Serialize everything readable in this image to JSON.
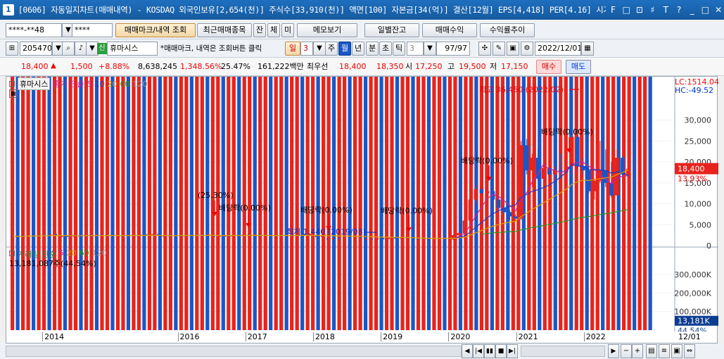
{
  "titlebar": {
    "icon_num": "1",
    "title": "[0606] 자동일지차트(매매내역) - KOSDAQ 외국인보유[2,654(천)] 주식수[33,910(천)] 액면[100] 자본금[34(억)] 결산[12월] EPS[4,418] PER[4.16] 시가",
    "buttons": [
      "F",
      "□",
      "⊡",
      "♯",
      "T",
      "?",
      "_",
      "□",
      "✕"
    ]
  },
  "row1": {
    "account": "****-**48",
    "password": "****",
    "btn_mark": "매매마크/내역 조회",
    "btn_recent": "최근매매종목",
    "btn_jan": "잔",
    "btn_che": "체",
    "btn_mi": "미",
    "btn_memo": "메모보기",
    "btn_daily": "일별잔고",
    "btn_profit": "매매수익",
    "btn_return": "수익률추이"
  },
  "row2": {
    "code": "205470",
    "stock_badge": "신",
    "stock_name": "휴마시스",
    "hint": "*매매마크, 내역은 조회버튼 클릭",
    "period_label": "일",
    "period_value": "3",
    "tabs": [
      "주",
      "월",
      "년",
      "분",
      "초",
      "틱"
    ],
    "active_tab": "월",
    "tick_value": "3",
    "page_count": "97/97",
    "date": "2022/12/01"
  },
  "row3": {
    "price": "18,400",
    "change": "1,500",
    "change_pct": "+8.88%",
    "volume": "8,638,245",
    "vol_ratio": "1,348.56%",
    "turnover": "25.47%",
    "amount": "161,222백만",
    "best_label": "최우선",
    "ask": "18,400",
    "bid": "18,350",
    "open_label": "시",
    "open": "17,250",
    "high_label": "고",
    "high": "19,500",
    "low_label": "저",
    "low": "17,150",
    "buy_btn": "매수",
    "sell_btn": "매도"
  },
  "price_panel": {
    "legend_name": "휴마시스",
    "legend_type": "종가 단순",
    "ma_labels": [
      "5",
      "10",
      "20",
      "60",
      "120"
    ],
    "ma_colors": [
      "#c8209a",
      "#1a3cc8",
      "#e0a000",
      "#209a20",
      "#9a9a9a"
    ],
    "lc": "LC:1514.04",
    "hc": "HC:-49.52",
    "yticks": [
      "30,000",
      "25,000",
      "20,000",
      "15,000",
      "10,000",
      "5,000",
      "0"
    ],
    "current_price": "18,400",
    "current_pct": "13.93%",
    "annotations": {
      "high": "최고 36,450 (2022/02)",
      "low": "최저 1,440 (2019/08)",
      "pct": "(25.30%)",
      "div1": "배당락(0.00%)",
      "div2": "배당락(0.00%)",
      "div3": "배당락(0.00%)",
      "div4": "배당락(0.00%)",
      "div5": "배당락(0.00%)"
    }
  },
  "volume_panel": {
    "legend_name": "거래량",
    "legend_type": "단순",
    "ma_labels": [
      "5",
      "20",
      "60",
      "120"
    ],
    "ma_colors": [
      "#c8209a",
      "#e0a000",
      "#209a20",
      "#9a9a9a"
    ],
    "summary": "13,181,087주(44,54%)",
    "yticks": [
      "300,000K",
      "200,000K",
      "100,000K"
    ],
    "current": "13,181K",
    "current_pct": "44,54%"
  },
  "xaxis": {
    "labels": [
      "2014",
      "2016",
      "2017",
      "2018",
      "2019",
      "2020",
      "2021",
      "2022",
      "12/01"
    ]
  },
  "colors": {
    "up": "#e8231c",
    "down": "#1a56c8",
    "ma5": "#c8209a",
    "ma20": "#e0a000",
    "ma60": "#209a20"
  },
  "chart_data": {
    "type": "candlestick",
    "title": "휴마시스",
    "ylim": [
      0,
      38000
    ],
    "months": [
      "2013-07",
      "2013-08",
      "2013-09",
      "2013-10",
      "2013-11",
      "2013-12",
      "2014-01",
      "2014-02",
      "2014-03",
      "2014-04",
      "2014-05",
      "2014-06",
      "2014-07",
      "2014-08",
      "2014-09",
      "2014-10",
      "2014-11",
      "2014-12",
      "2015-01",
      "2015-02",
      "2015-03",
      "2015-04",
      "2015-05",
      "2015-06",
      "2015-07",
      "2015-08",
      "2015-09",
      "2015-10",
      "2015-11",
      "2015-12",
      "2016-01",
      "2016-02",
      "2016-03",
      "2016-04",
      "2016-05",
      "2016-06",
      "2016-07",
      "2016-08",
      "2016-09",
      "2016-10",
      "2016-11",
      "2016-12",
      "2017-01",
      "2017-02",
      "2017-03",
      "2017-04",
      "2017-05",
      "2017-06",
      "2017-07",
      "2017-08",
      "2017-09",
      "2017-10",
      "2017-11",
      "2017-12",
      "2018-01",
      "2018-02",
      "2018-03",
      "2018-04",
      "2018-05",
      "2018-06",
      "2018-07",
      "2018-08",
      "2018-09",
      "2018-10",
      "2018-11",
      "2018-12",
      "2019-01",
      "2019-02",
      "2019-03",
      "2019-04",
      "2019-05",
      "2019-06",
      "2019-07",
      "2019-08",
      "2019-09",
      "2019-10",
      "2019-11",
      "2019-12",
      "2020-01",
      "2020-02",
      "2020-03",
      "2020-04",
      "2020-05",
      "2020-06",
      "2020-07",
      "2020-08",
      "2020-09",
      "2020-10",
      "2020-11",
      "2020-12",
      "2021-01",
      "2021-02",
      "2021-03",
      "2021-04",
      "2021-05",
      "2021-06",
      "2021-07",
      "2021-08",
      "2021-09",
      "2021-10",
      "2021-11",
      "2021-12",
      "2022-01",
      "2022-02",
      "2022-03",
      "2022-04",
      "2022-05",
      "2022-06",
      "2022-07",
      "2022-08",
      "2022-09",
      "2022-10",
      "2022-11",
      "2022-12"
    ],
    "candles_ohlc_2020_2022": [
      [
        1500,
        2600,
        1400,
        2500
      ],
      [
        2500,
        3200,
        2300,
        3000
      ],
      [
        3000,
        6500,
        2900,
        6000
      ],
      [
        6000,
        12000,
        5800,
        11000
      ],
      [
        11000,
        14500,
        10000,
        13500
      ],
      [
        13500,
        14200,
        12000,
        12500
      ],
      [
        12500,
        13500,
        11500,
        13000
      ],
      [
        13000,
        13500,
        10500,
        11000
      ],
      [
        11000,
        11500,
        8500,
        9000
      ],
      [
        9000,
        9500,
        7500,
        8000
      ],
      [
        8000,
        8500,
        6000,
        7000
      ],
      [
        7000,
        7500,
        5800,
        6500
      ],
      [
        6500,
        25000,
        6200,
        24000
      ],
      [
        24000,
        25500,
        17000,
        18000
      ],
      [
        18000,
        22000,
        14000,
        21000
      ],
      [
        21000,
        23000,
        15000,
        16000
      ],
      [
        16000,
        19500,
        15500,
        18500
      ],
      [
        18500,
        19000,
        16000,
        17000
      ],
      [
        17000,
        19000,
        15500,
        18000
      ],
      [
        18000,
        22000,
        16000,
        17500
      ],
      [
        17500,
        21000,
        16500,
        19000
      ],
      [
        19000,
        27000,
        17000,
        26000
      ],
      [
        26000,
        36450,
        18000,
        19000
      ],
      [
        19000,
        21000,
        17000,
        18000
      ],
      [
        18000,
        19000,
        12500,
        13000
      ],
      [
        13000,
        16000,
        11000,
        15500
      ],
      [
        15500,
        25000,
        15000,
        18000
      ],
      [
        18000,
        23000,
        14000,
        15000
      ],
      [
        15000,
        20000,
        11500,
        12000
      ],
      [
        12000,
        23000,
        12000,
        21000
      ],
      [
        21000,
        21500,
        16500,
        17000
      ],
      [
        16900,
        19500,
        15000,
        18400
      ]
    ],
    "volume_k": [
      2000,
      3000,
      5000,
      4000,
      6000,
      20000,
      3000,
      25000,
      8000,
      4000,
      3000,
      6000,
      5000,
      4000,
      3000,
      25000,
      10000,
      6000,
      4000,
      3000,
      8000,
      4000,
      3000,
      5000,
      4000,
      3000,
      25000,
      8000,
      4000,
      6000,
      3000,
      5000,
      4000,
      6000,
      3000,
      26000,
      5000,
      4000,
      6000,
      3000,
      30000,
      10000,
      5000,
      25000,
      20000,
      8000,
      5000,
      4000,
      3000,
      25000,
      5000,
      30000,
      15000,
      8000,
      4000,
      20000,
      4000,
      6000,
      3000,
      20000,
      10000,
      4000,
      3000,
      25000,
      8000,
      6000,
      3000,
      25000,
      5000,
      4000,
      20000,
      8000,
      4000,
      3000,
      6000,
      4000,
      5000,
      3000,
      10000,
      6000,
      25000,
      15000,
      8000,
      5000,
      6000,
      4000,
      20000,
      10000,
      345000,
      370000,
      260000,
      210000,
      180000,
      140000,
      80000,
      50000,
      120000,
      60000,
      100000,
      40000,
      70000,
      30000,
      220000,
      60000,
      120000,
      50000,
      80000,
      60000,
      250000,
      100000,
      70000,
      240000,
      130000,
      90000,
      30000,
      20000,
      40000,
      30000,
      110000,
      60000,
      20000,
      13181
    ]
  }
}
